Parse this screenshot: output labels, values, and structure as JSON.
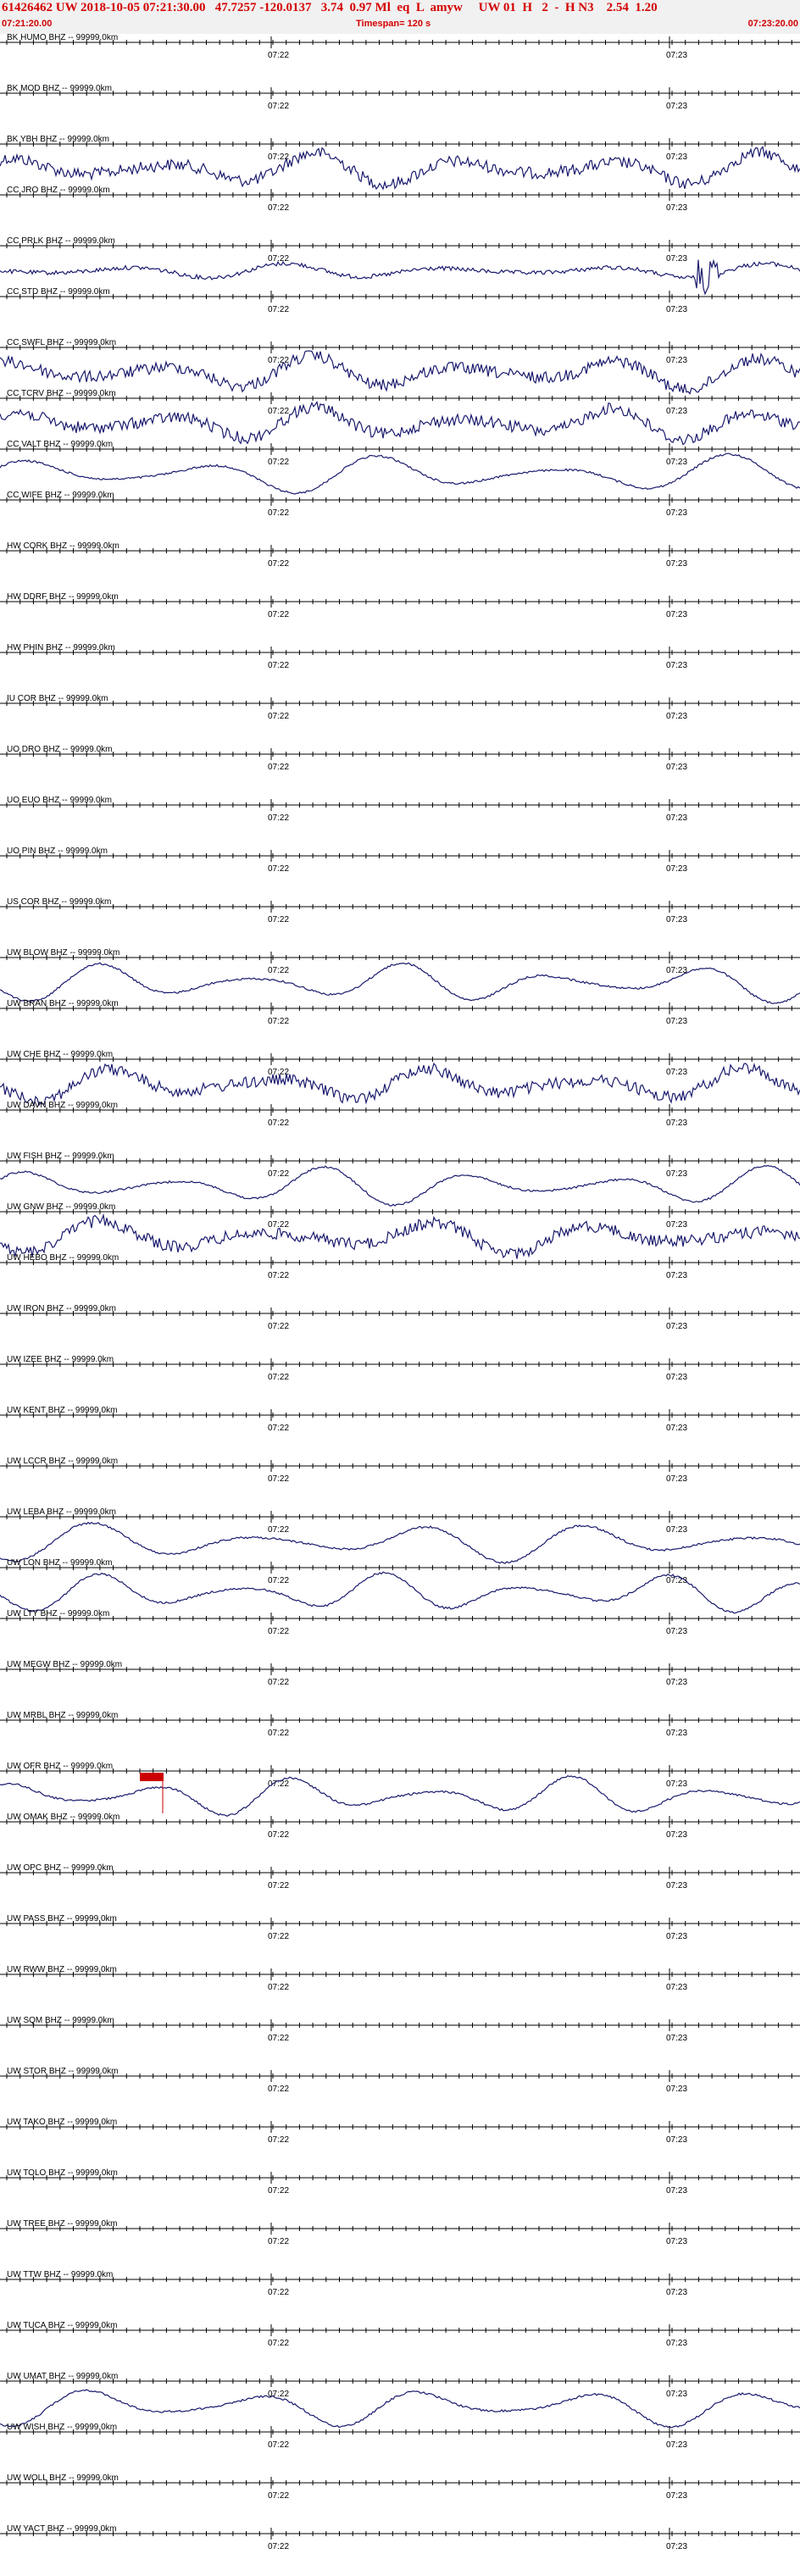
{
  "header": {
    "title": "61426462 UW 2018-10-05 07:21:30.00   47.7257 -120.0137   3.74  0.97 Ml  eq  L  amyw     UW 01  H   2  -  H N3    2.54  1.20",
    "start_time": "07:21:20.00",
    "timespan": "Timespan= 120 s",
    "end_time": "07:23:20.00"
  },
  "colors": {
    "header_text": "#d40000",
    "header_bg": "#f1f1f1",
    "trace": "#1a1a6e",
    "axis": "#000000",
    "pick": "#cc0000"
  },
  "chart_data": {
    "type": "line",
    "x_range": [
      "07:21:20.00",
      "07:23:20.00"
    ],
    "time_tick_labels": [
      "07:22",
      "07:23"
    ],
    "channels": [
      {
        "label": "BK HUMO BHZ -- 99999.0km",
        "trace": false
      },
      {
        "label": "BK MOD BHZ -- 99999.0km",
        "trace": false
      },
      {
        "label": "BK YBH BHZ -- 99999.0km",
        "trace": true,
        "style": "noisy"
      },
      {
        "label": "CC JRO BHZ -- 99999.0km",
        "trace": false
      },
      {
        "label": "CC PRLK BHZ -- 99999.0km",
        "trace": true,
        "style": "flat"
      },
      {
        "label": "CC STD BHZ -- 99999.0km",
        "trace": false
      },
      {
        "label": "CC SWFL BHZ -- 99999.0km",
        "trace": true,
        "style": "noisy"
      },
      {
        "label": "CC TCRV BHZ -- 99999.0km",
        "trace": true,
        "style": "noisy"
      },
      {
        "label": "CC VALT BHZ -- 99999.0km",
        "trace": true,
        "style": "smooth"
      },
      {
        "label": "CC WIFE BHZ -- 99999.0km",
        "trace": false
      },
      {
        "label": "HW CORK BHZ -- 99999.0km",
        "trace": false
      },
      {
        "label": "HW DDRF BHZ -- 99999.0km",
        "trace": false
      },
      {
        "label": "HW PHIN BHZ -- 99999.0km",
        "trace": false
      },
      {
        "label": "IU COR BHZ -- 99999.0km",
        "trace": false
      },
      {
        "label": "UO DRO BHZ -- 99999.0km",
        "trace": false
      },
      {
        "label": "UO EUO BHZ -- 99999.0km",
        "trace": false
      },
      {
        "label": "UO PIN BHZ -- 99999.0km",
        "trace": false
      },
      {
        "label": "US COR BHZ -- 99999.0km",
        "trace": false
      },
      {
        "label": "UW BLOW BHZ -- 99999.0km",
        "trace": true,
        "style": "smooth"
      },
      {
        "label": "UW BRAN BHZ -- 99999.0km",
        "trace": false
      },
      {
        "label": "UW CHE BHZ -- 99999.0km",
        "trace": true,
        "style": "noisy"
      },
      {
        "label": "UW DAVN BHZ -- 99999.0km",
        "trace": false
      },
      {
        "label": "UW FISH BHZ -- 99999.0km",
        "trace": true,
        "style": "smooth"
      },
      {
        "label": "UW GNW BHZ -- 99999.0km",
        "trace": true,
        "style": "noisy"
      },
      {
        "label": "UW HEBO BHZ -- 99999.0km",
        "trace": false
      },
      {
        "label": "UW IRON BHZ -- 99999.0km",
        "trace": false
      },
      {
        "label": "UW IZEE BHZ -- 99999.0km",
        "trace": false
      },
      {
        "label": "UW KENT BHZ -- 99999.0km",
        "trace": false
      },
      {
        "label": "UW LCCR BHZ -- 99999.0km",
        "trace": false
      },
      {
        "label": "UW LEBA BHZ -- 99999.0km",
        "trace": true,
        "style": "smooth"
      },
      {
        "label": "UW LON BHZ -- 99999.0km",
        "trace": true,
        "style": "smooth"
      },
      {
        "label": "UW LTY BHZ -- 99999.0km",
        "trace": false
      },
      {
        "label": "UW MEGW BHZ -- 99999.0km",
        "trace": false
      },
      {
        "label": "UW MRBL BHZ -- 99999.0km",
        "trace": false
      },
      {
        "label": "UW OFR BHZ -- 99999.0km",
        "trace": true,
        "style": "smooth",
        "pick": true
      },
      {
        "label": "UW OMAK BHZ -- 99999.0km",
        "trace": false
      },
      {
        "label": "UW OPC BHZ -- 99999.0km",
        "trace": false
      },
      {
        "label": "UW PASS BHZ -- 99999.0km",
        "trace": false
      },
      {
        "label": "UW RWW BHZ -- 99999.0km",
        "trace": false
      },
      {
        "label": "UW SQM BHZ -- 99999.0km",
        "trace": false
      },
      {
        "label": "UW STOR BHZ -- 99999.0km",
        "trace": false
      },
      {
        "label": "UW TAKO BHZ -- 99999.0km",
        "trace": false
      },
      {
        "label": "UW TOLO BHZ -- 99999.0km",
        "trace": false
      },
      {
        "label": "UW TREE BHZ -- 99999.0km",
        "trace": false
      },
      {
        "label": "UW TTW BHZ -- 99999.0km",
        "trace": false
      },
      {
        "label": "UW TUCA BHZ -- 99999.0km",
        "trace": false
      },
      {
        "label": "UW UMAT BHZ -- 99999.0km",
        "trace": true,
        "style": "smooth"
      },
      {
        "label": "UW WISH BHZ -- 99999.0km",
        "trace": false
      },
      {
        "label": "UW WOLL BHZ -- 99999.0km",
        "trace": false
      },
      {
        "label": "UW YACT BHZ -- 99999.0km",
        "trace": false
      }
    ]
  }
}
